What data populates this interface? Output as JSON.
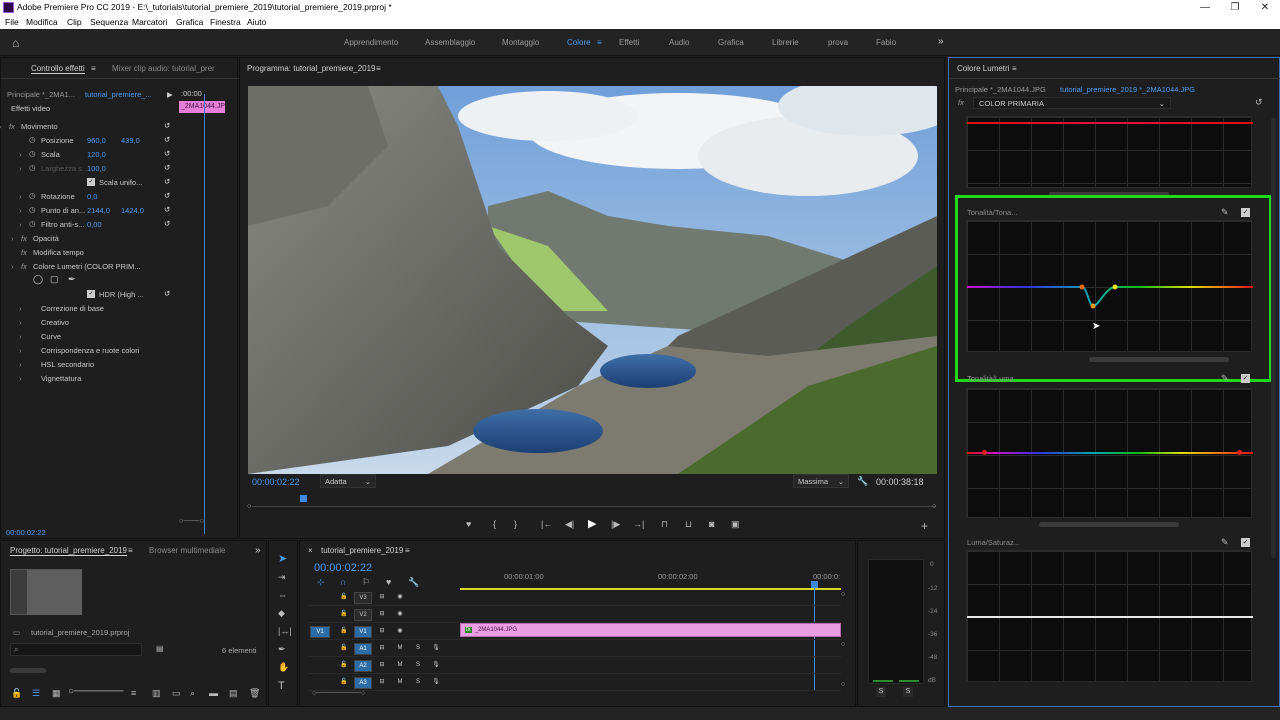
{
  "window": {
    "title": "Adobe Premiere Pro CC 2019 - E:\\_tutorials\\tutorial_premiere_2019\\tutorial_premiere_2019.prproj *",
    "minimize": "—",
    "maximize": "❐",
    "close": "✕"
  },
  "menu": [
    "File",
    "Modifica",
    "Clip",
    "Sequenza",
    "Marcatori",
    "Grafica",
    "Finestra",
    "Aiuto"
  ],
  "workspaces": [
    "Apprendimento",
    "Assemblaggio",
    "Montaggio",
    "Colore",
    "Effetti",
    "Audio",
    "Grafica",
    "Librerie",
    "prova",
    "Fabio"
  ],
  "effect_controls": {
    "tab": "Controllo effetti",
    "tab2": "Mixer clip audio: tutorial_prer",
    "source": "Principale *_2MA1...",
    "seq": "tutorial_premiere_...",
    "timecode_head": ":00:00",
    "clip_label": "_2MA1044.JPG",
    "section": "Effetti video",
    "rows": [
      {
        "label": "Movimento"
      },
      {
        "label": "Posizione",
        "v1": "960,0",
        "v2": "439,0"
      },
      {
        "label": "Scala",
        "v1": "120,0"
      },
      {
        "label": "Larghezza s...",
        "v1": "100,0"
      },
      {
        "label": "Scala unifo..."
      },
      {
        "label": "Rotazione",
        "v1": "0,0"
      },
      {
        "label": "Punto di an...",
        "v1": "2144,0",
        "v2": "1424,0"
      },
      {
        "label": "Filtro anti-s...",
        "v1": "0,00"
      },
      {
        "label": "Opacità"
      },
      {
        "label": "Modifica tempo"
      },
      {
        "label": "Colore Lumetri (COLOR PRIM..."
      },
      {
        "label": "HDR (High ..."
      },
      {
        "label": "Correzione di base"
      },
      {
        "label": "Creativo"
      },
      {
        "label": "Curve"
      },
      {
        "label": "Corrispondenza e ruote colori"
      },
      {
        "label": "HSL secondario"
      },
      {
        "label": "Vignettatura"
      }
    ],
    "timecode": "00:00:02:22"
  },
  "program": {
    "tab": "Programma: tutorial_premiere_2019",
    "timecode": "00:00:02:22",
    "fit": "Adatta",
    "quality": "Massima",
    "duration": "00:00:38:18",
    "playhead_fraction": 0.075
  },
  "project": {
    "tab": "Progetto: tutorial_premiere_2019",
    "tab2": "Browser multimediale",
    "file": "tutorial_premiere_2019.prproj",
    "count": "6 elementi"
  },
  "timeline": {
    "tab": "tutorial_premiere_2019",
    "timecode": "00:00:02:22",
    "ruler": [
      "00:00:01:00",
      "00:00:02:00",
      "00:00:0:"
    ],
    "tracks": [
      {
        "name": "V3",
        "src": ""
      },
      {
        "name": "V2",
        "src": ""
      },
      {
        "name": "V1",
        "src": "V1"
      },
      {
        "name": "A1",
        "src": ""
      },
      {
        "name": "A2",
        "src": ""
      },
      {
        "name": "A3",
        "src": ""
      }
    ],
    "clip": "_2MA1044.JPG",
    "meter_labels": [
      "0",
      "-12",
      "-24",
      "-36",
      "-48",
      "dB"
    ],
    "meter_solo": [
      "S",
      "S"
    ]
  },
  "lumetri": {
    "tab": "Colore Lumetri",
    "source": "Principale *_2MA1044.JPG",
    "seq": "tutorial_premiere_2019 *_2MA1044.JPG",
    "effect": "COLOR PRIMARIA",
    "curve1": "Tonalità/Tona...",
    "curve2": "Tonalità/Luma",
    "curve3": "Luma/Saturaz...",
    "highlight_color": "#1ed81e"
  }
}
